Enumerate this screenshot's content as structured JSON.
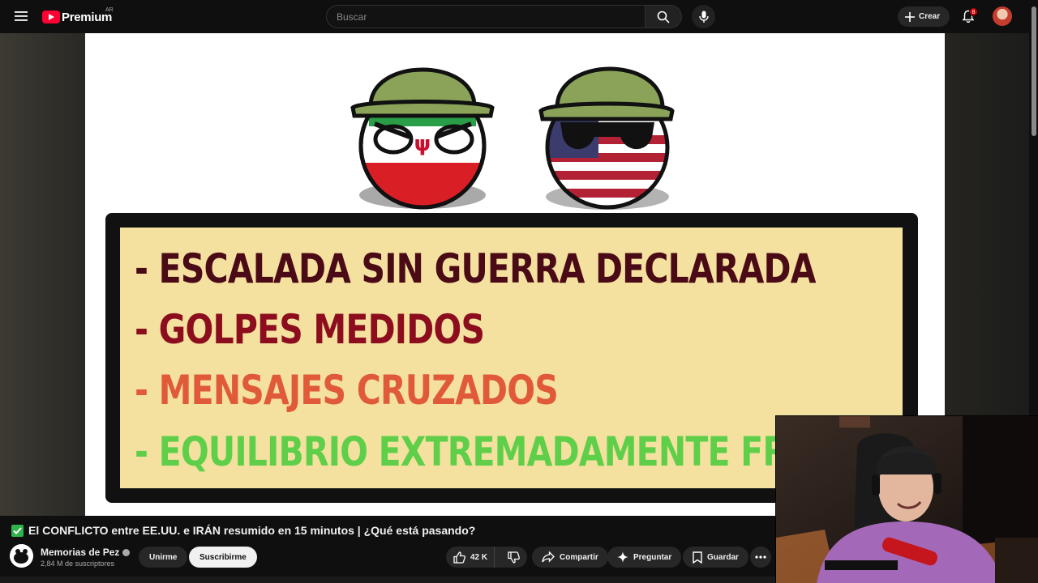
{
  "masthead": {
    "logo_text": "Premium",
    "country_code": "AR",
    "search_placeholder": "Buscar",
    "create_label": "Crear",
    "notification_count": "8"
  },
  "video_slide": {
    "lines": [
      "- ESCALADA SIN GUERRA DECLARADA",
      "- GOLPES MEDIDOS",
      "- MENSAJES CRUZADOS",
      "- EQUILIBRIO EXTREMADAMENTE FR"
    ]
  },
  "video": {
    "title": "El CONFLICTO entre EE.UU. e IRÁN resumido en 15 minutos | ¿Qué está pasando?",
    "channel_name": "Memorias de Pez",
    "subscribers": "2,84 M de suscriptores",
    "join_label": "Unirme",
    "subscribe_label": "Suscribirme",
    "likes": "42 K",
    "share_label": "Compartir",
    "ask_label": "Preguntar",
    "save_label": "Guardar"
  },
  "colors": {
    "brand_red": "#ff0033",
    "slide_background": "#f4e1a0",
    "line1": "#4b0b16",
    "line2": "#8c0e1e",
    "line3": "#e05a3a",
    "line4": "#5fcf4a"
  }
}
